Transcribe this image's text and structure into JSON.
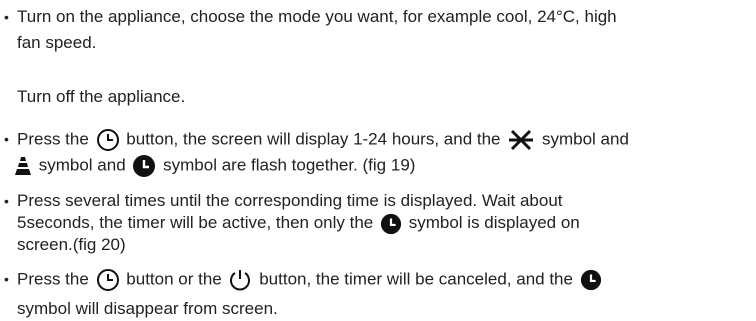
{
  "items": [
    {
      "line1": "Turn on the appliance, choose the mode you want, for example cool, 24°C, high",
      "line2": "fan speed."
    },
    {
      "line1": "Turn off the appliance."
    },
    {
      "p1": "Press the",
      "p2": "button, the screen will display 1-24 hours, and the",
      "p3": "symbol and",
      "p4": "symbol and",
      "p5": "symbol are flash together. (fig 19)"
    },
    {
      "line1": "Press several times until the corresponding time is displayed. Wait about",
      "line2_a": "5seconds, the timer will be active, then only the",
      "line2_b": "symbol is displayed on",
      "line3": "screen.(fig 20)"
    },
    {
      "p1": "Press the",
      "p2": "button or the",
      "p3": "button, the timer will be canceled, and the",
      "line2": "symbol will disappear from screen."
    }
  ],
  "icons": {
    "timer_outline": "timer-outline-icon",
    "cool_snowflake": "cool-mode-icon",
    "fan_level": "fan-speed-icon",
    "timer_filled": "timer-filled-icon",
    "power": "power-icon"
  },
  "colors": {
    "text": "#222222",
    "icon": "#111111"
  }
}
